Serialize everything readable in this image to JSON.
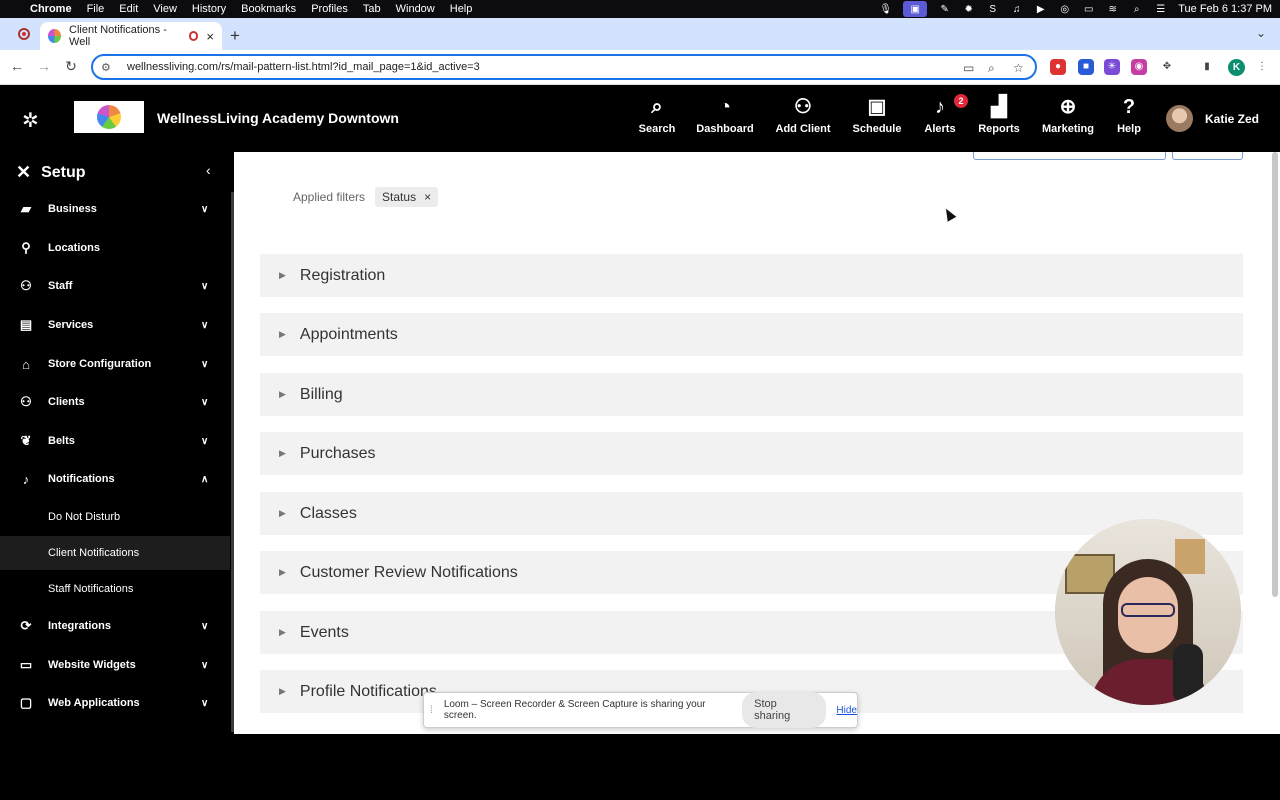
{
  "macos_menu": {
    "app": "Chrome",
    "items": [
      "File",
      "Edit",
      "View",
      "History",
      "Bookmarks",
      "Profiles",
      "Tab",
      "Window",
      "Help"
    ],
    "clock": "Tue Feb 6  1:37 PM"
  },
  "browser": {
    "tab_title": "Client Notifications - Well",
    "url": "wellnessliving.com/rs/mail-pattern-list.html?id_mail_page=1&id_active=3"
  },
  "header": {
    "business_name": "WellnessLiving Academy Downtown",
    "nav": [
      {
        "label": "Search",
        "icon": "search-icon"
      },
      {
        "label": "Dashboard",
        "icon": "dashboard-icon"
      },
      {
        "label": "Add Client",
        "icon": "add-user-icon"
      },
      {
        "label": "Schedule",
        "icon": "calendar-icon"
      },
      {
        "label": "Alerts",
        "icon": "bell-icon",
        "badge": "2"
      },
      {
        "label": "Reports",
        "icon": "chart-icon"
      },
      {
        "label": "Marketing",
        "icon": "target-icon"
      },
      {
        "label": "Help",
        "icon": "help-icon"
      }
    ],
    "user_name": "Katie Zed"
  },
  "sidebar": {
    "title": "Setup",
    "items": [
      {
        "label": "Business",
        "icon": "briefcase-icon",
        "expandable": true
      },
      {
        "label": "Locations",
        "icon": "location-icon",
        "expandable": false
      },
      {
        "label": "Staff",
        "icon": "person-icon",
        "expandable": true
      },
      {
        "label": "Services",
        "icon": "services-icon",
        "expandable": true
      },
      {
        "label": "Store Configuration",
        "icon": "store-icon",
        "expandable": true
      },
      {
        "label": "Clients",
        "icon": "person-icon",
        "expandable": true
      },
      {
        "label": "Belts",
        "icon": "belt-icon",
        "expandable": true
      },
      {
        "label": "Notifications",
        "icon": "bell-icon",
        "expanded": true
      },
      {
        "label": "Integrations",
        "icon": "integrations-icon",
        "expandable": true
      },
      {
        "label": "Website Widgets",
        "icon": "widget-icon",
        "expandable": true
      },
      {
        "label": "Web Applications",
        "icon": "monitor-icon",
        "expandable": true
      }
    ],
    "notifications_sub": [
      "Do Not Disturb",
      "Client Notifications",
      "Staff Notifications"
    ],
    "active_sub": "Client Notifications"
  },
  "main": {
    "filters_label": "Applied filters",
    "filter_chips": [
      "Status"
    ],
    "sections": [
      "Registration",
      "Appointments",
      "Billing",
      "Purchases",
      "Classes",
      "Customer Review Notifications",
      "Events",
      "Profile Notifications"
    ]
  },
  "loom": {
    "message": "Loom – Screen Recorder & Screen Capture is sharing your screen.",
    "stop_label": "Stop sharing",
    "hide_label": "Hide"
  },
  "colors": {
    "accent_blue": "#1a73e8",
    "alert_badge": "#e0283a",
    "tab_strip": "#d3e3fd",
    "section_bg": "#f2f2f2"
  }
}
